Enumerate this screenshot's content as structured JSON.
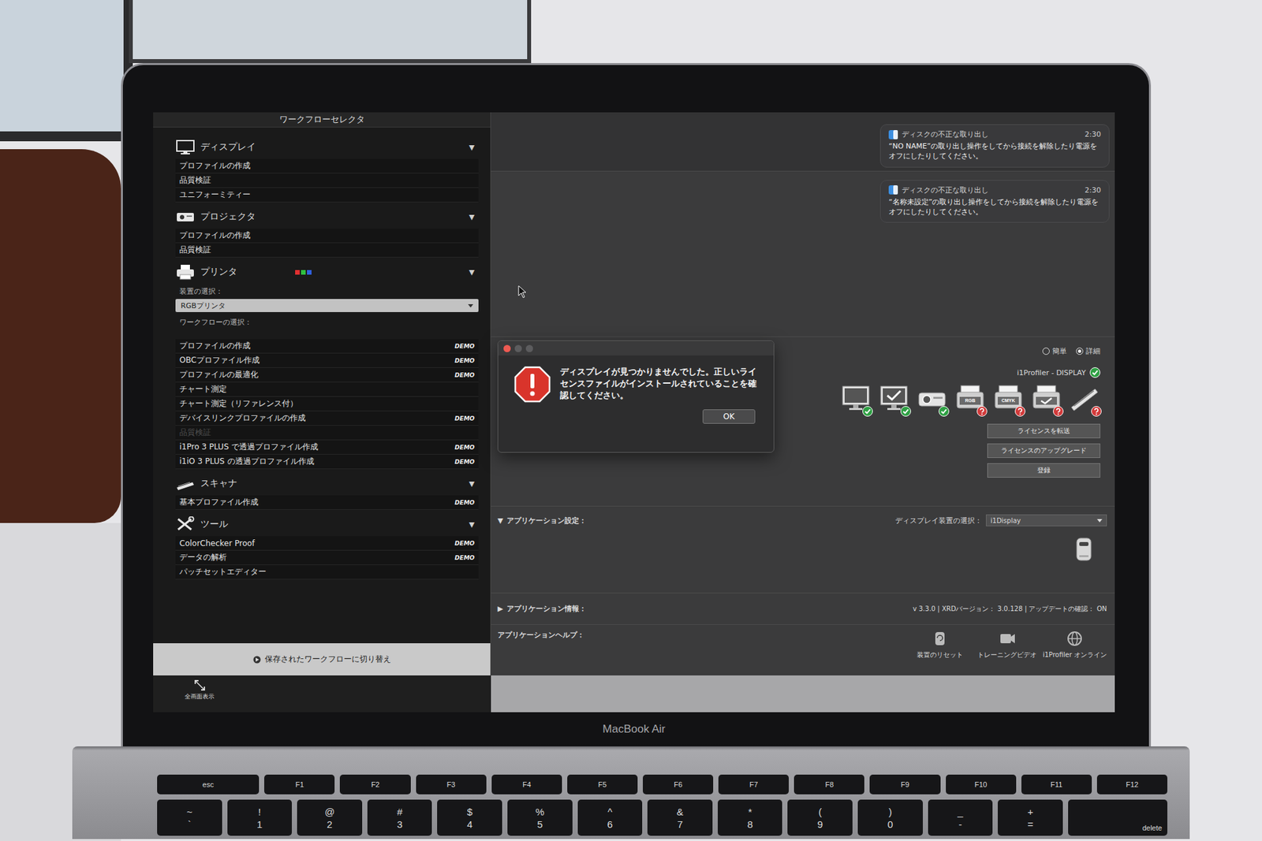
{
  "sidebar": {
    "title": "ワークフローセレクタ",
    "sections": [
      {
        "kind": "display",
        "label": "ディスプレイ",
        "toggle": "▼",
        "expanded": true,
        "items": [
          {
            "label": "プロファイルの作成",
            "disabled": false
          },
          {
            "label": "品質検証",
            "disabled": false
          },
          {
            "label": "ユニフォーミティー",
            "disabled": false
          }
        ]
      },
      {
        "kind": "projector",
        "label": "プロジェクタ",
        "toggle": "▼",
        "expanded": true,
        "items": [
          {
            "label": "プロファイルの作成",
            "disabled": false
          },
          {
            "label": "品質検証",
            "disabled": false
          }
        ]
      },
      {
        "kind": "printer",
        "label": "プリンタ",
        "toggle": "▼",
        "expanded": true,
        "device_label": "装置の選択：",
        "device_value": "RGBプリンタ",
        "workflow_label": "ワークフローの選択：",
        "items": [
          {
            "label": "プロファイルの作成",
            "badge": "DEMO",
            "disabled": false
          },
          {
            "label": "OBCプロファイル作成",
            "badge": "DEMO",
            "disabled": false
          },
          {
            "label": "プロファイルの最適化",
            "badge": "DEMO",
            "disabled": false
          },
          {
            "label": "チャート測定",
            "disabled": false
          },
          {
            "label": "チャート測定（リファレンス付）",
            "disabled": false
          },
          {
            "label": "デバイスリンクプロファイルの作成",
            "badge": "DEMO",
            "disabled": false
          },
          {
            "label": "品質検証",
            "disabled": true
          },
          {
            "label": "i1Pro 3 PLUS で透過プロファイル作成",
            "badge": "DEMO",
            "disabled": false
          },
          {
            "label": "i1iO 3 PLUS の透過プロファイル作成",
            "badge": "DEMO",
            "disabled": false
          }
        ]
      },
      {
        "kind": "scanner",
        "label": "スキャナ",
        "toggle": "▼",
        "expanded": true,
        "items": [
          {
            "label": "基本プロファイル作成",
            "badge": "DEMO",
            "disabled": false
          }
        ]
      },
      {
        "kind": "tools",
        "label": "ツール",
        "toggle": "▼",
        "expanded": true,
        "items": [
          {
            "label": "ColorChecker Proof",
            "badge": "DEMO",
            "disabled": false
          },
          {
            "label": "データの解析",
            "badge": "DEMO",
            "disabled": false
          },
          {
            "label": "パッチセットエディター",
            "disabled": false
          }
        ]
      }
    ],
    "footer_button": "保存されたワークフローに切り替え",
    "fullscreen_label": "全画面表示"
  },
  "mode_options": [
    {
      "label": "簡単",
      "selected": false
    },
    {
      "label": "詳細",
      "selected": true
    }
  ],
  "product": {
    "label": "i1Profiler - DISPLAY",
    "licensed": true
  },
  "modules": [
    {
      "kind": "display",
      "licensed": true
    },
    {
      "kind": "display-quality",
      "licensed": true
    },
    {
      "kind": "projector",
      "licensed": true
    },
    {
      "kind": "rgb-printer",
      "label": "RGB",
      "licensed": false
    },
    {
      "kind": "cmyk-printer",
      "label": "CMYK",
      "licensed": false
    },
    {
      "kind": "printer-quality",
      "licensed": false
    },
    {
      "kind": "scanner",
      "licensed": false
    }
  ],
  "license_buttons": [
    "ライセンスを転送",
    "ライセンスのアップグレード",
    "登録"
  ],
  "settings": {
    "toggle": "▼",
    "label": "アプリケーション設定：",
    "device_label": "ディスプレイ装置の選択：",
    "device_value": "i1Display"
  },
  "info": {
    "toggle": "▶",
    "label": "アプリケーション情報：",
    "version": "v 3.3.0 | XRDバージョン： 3.0.128 | アップデートの確認： ON"
  },
  "help": {
    "label": "アプリケーションヘルプ：",
    "items": [
      {
        "kind": "reset",
        "label": "装置のリセット"
      },
      {
        "kind": "video",
        "label": "トレーニングビデオ"
      },
      {
        "kind": "online",
        "label": "i1Profiler オンライン"
      }
    ]
  },
  "notifications": [
    {
      "title": "ディスクの不正な取り出し",
      "time": "2:30",
      "body": "“NO NAME”の取り出し操作をしてから接続を解除したり電源をオフにしたりしてください。"
    },
    {
      "title": "ディスクの不正な取り出し",
      "time": "2:30",
      "body": "“名称未設定”の取り出し操作をしてから接続を解除したり電源をオフにしたりしてください。"
    }
  ],
  "dialog": {
    "message": "ディスプレイが見つかりませんでした。正しいライセンスファイルがインストールされていることを確認してください。",
    "button": "OK"
  },
  "laptop": {
    "brand": "MacBook Air"
  },
  "keyboard": {
    "function_row": [
      "esc",
      "F1",
      "F2",
      "F3",
      "F4",
      "F5",
      "F6",
      "F7",
      "F8",
      "F9",
      "F10",
      "F11",
      "F12"
    ],
    "number_row": [
      {
        "top": "~",
        "bottom": "`"
      },
      {
        "top": "!",
        "bottom": "1"
      },
      {
        "top": "@",
        "bottom": "2"
      },
      {
        "top": "#",
        "bottom": "3"
      },
      {
        "top": "$",
        "bottom": "4"
      },
      {
        "top": "%",
        "bottom": "5"
      },
      {
        "top": "^",
        "bottom": "6"
      },
      {
        "top": "&",
        "bottom": "7"
      },
      {
        "top": "*",
        "bottom": "8"
      },
      {
        "top": "(",
        "bottom": "9"
      },
      {
        "top": ")",
        "bottom": "0"
      },
      {
        "top": "_",
        "bottom": "-"
      },
      {
        "top": "+",
        "bottom": "="
      }
    ],
    "delete_key": "delete"
  }
}
